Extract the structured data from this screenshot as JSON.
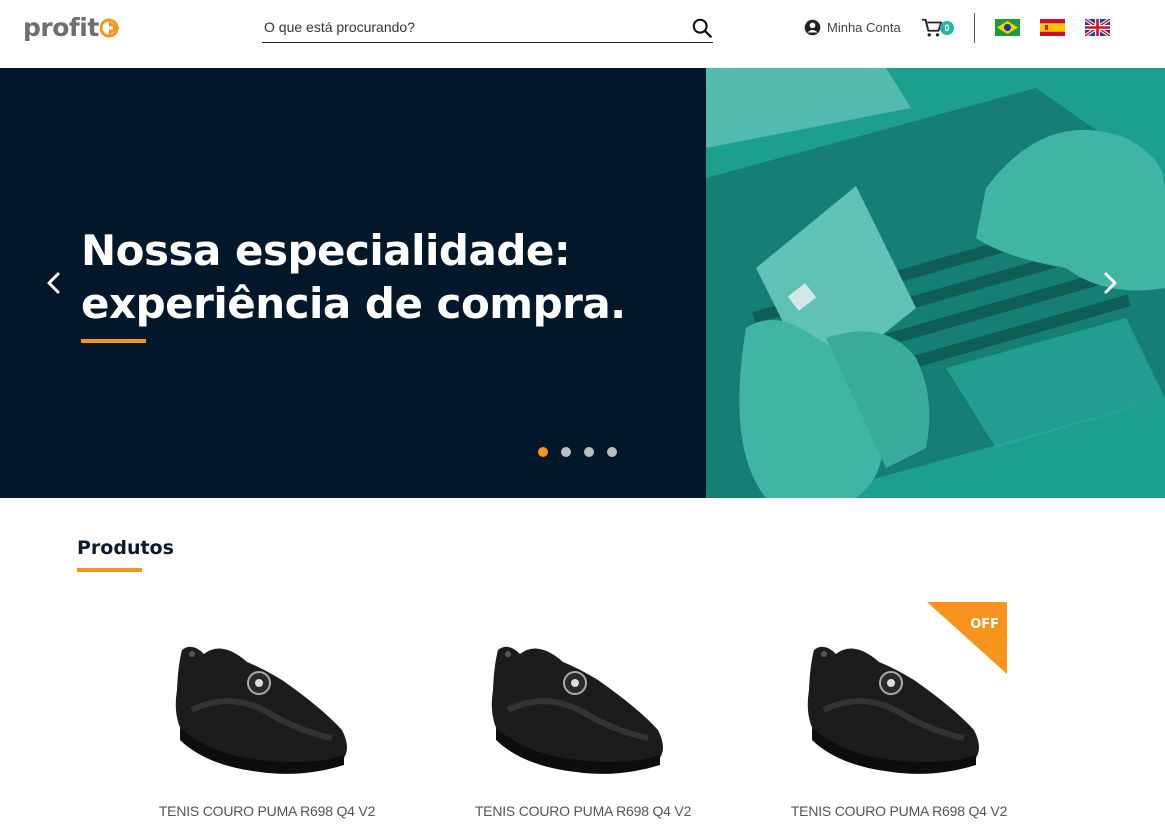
{
  "brand": {
    "logo_text": "profit",
    "accent": "#f7941d",
    "teal": "#2bb3a3",
    "navy": "#03172a"
  },
  "header": {
    "search_placeholder": "O que está procurando?",
    "account_label": "Minha Conta",
    "cart_count": "0",
    "flags": [
      "flag-brazil",
      "flag-spain",
      "flag-uk"
    ]
  },
  "hero": {
    "title_line1": "Nossa especialidade:",
    "title_line2": "experiência de compra.",
    "slides_total": 4,
    "active_slide": 1
  },
  "products": {
    "section_title": "Produtos",
    "items": [
      {
        "name": "TENIS COURO PUMA R698 Q4 V2",
        "badge": ""
      },
      {
        "name": "TENIS COURO PUMA R698 Q4 V2",
        "badge": ""
      },
      {
        "name": "TENIS COURO PUMA R698 Q4 V2",
        "badge": "OFF"
      }
    ]
  }
}
